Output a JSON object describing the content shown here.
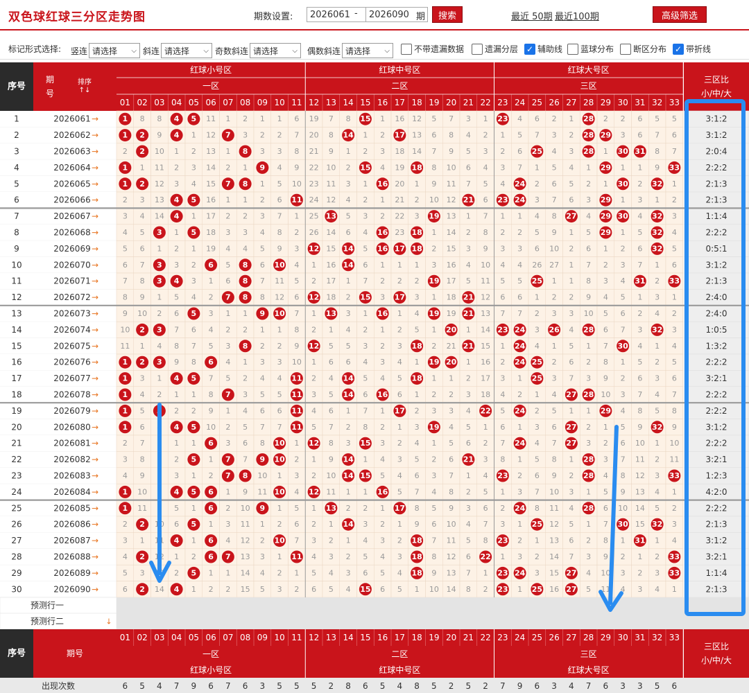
{
  "header": {
    "title": "双色球红球三分区走势图",
    "period_label": "期数设置:",
    "period_start": "2026061",
    "period_end": "2026090",
    "dash": "-",
    "period_unit": "期",
    "search_button": "搜索",
    "recent50": "最近 50期",
    "recent100": "最近100期",
    "advanced_button": "高级筛选"
  },
  "options": {
    "mark_label": "标记形式选择:",
    "selects": [
      {
        "label": "竖连",
        "value": "请选择"
      },
      {
        "label": "斜连",
        "value": "请选择"
      },
      {
        "label": "奇数斜连",
        "value": "请选择"
      },
      {
        "label": "偶数斜连",
        "value": "请选择"
      }
    ],
    "checkboxes": [
      {
        "label": "不带遗漏数据",
        "checked": false
      },
      {
        "label": "遗漏分层",
        "checked": false
      },
      {
        "label": "辅助线",
        "checked": true
      },
      {
        "label": "蓝球分布",
        "checked": false
      },
      {
        "label": "断区分布",
        "checked": false
      },
      {
        "label": "带折线",
        "checked": true
      }
    ]
  },
  "table": {
    "col_index": "序号",
    "col_period": "期号",
    "sort_label": "排序",
    "zone_names": [
      "红球小号区",
      "红球中号区",
      "红球大号区"
    ],
    "zone_labels": [
      "一区",
      "二区",
      "三区"
    ],
    "ratio_header": [
      "三区比",
      "小/中/大"
    ],
    "numbers": [
      "01",
      "02",
      "03",
      "04",
      "05",
      "06",
      "07",
      "08",
      "09",
      "10",
      "11",
      "12",
      "13",
      "14",
      "15",
      "16",
      "17",
      "18",
      "19",
      "20",
      "21",
      "22",
      "23",
      "24",
      "25",
      "26",
      "27",
      "28",
      "29",
      "30",
      "31",
      "32",
      "33"
    ],
    "predict_rows": [
      "预测行一",
      "预测行二"
    ],
    "count_label": "出现次数",
    "counts": [
      6,
      5,
      4,
      7,
      9,
      6,
      7,
      6,
      3,
      5,
      5,
      5,
      2,
      8,
      6,
      5,
      4,
      8,
      5,
      2,
      5,
      2,
      7,
      9,
      6,
      3,
      4,
      7,
      6,
      3,
      3,
      5,
      6
    ],
    "rows": [
      {
        "idx": 1,
        "period": "2026061",
        "ratio": "3:1:2",
        "cells": [
          1,
          8,
          8,
          4,
          5,
          11,
          1,
          2,
          1,
          1,
          6,
          19,
          7,
          8,
          15,
          1,
          16,
          12,
          5,
          7,
          3,
          1,
          23,
          4,
          6,
          2,
          1,
          28,
          2,
          2,
          6,
          5,
          5
        ]
      },
      {
        "idx": 2,
        "period": "2026062",
        "ratio": "3:1:2",
        "cells": [
          1,
          2,
          9,
          4,
          1,
          12,
          7,
          3,
          2,
          2,
          7,
          20,
          8,
          14,
          1,
          2,
          17,
          13,
          6,
          8,
          4,
          2,
          1,
          5,
          7,
          3,
          2,
          28,
          29,
          3,
          6,
          7,
          6
        ]
      },
      {
        "idx": 3,
        "period": "2026063",
        "ratio": "2:0:4",
        "cells": [
          2,
          2,
          10,
          1,
          2,
          13,
          1,
          8,
          3,
          3,
          8,
          21,
          9,
          1,
          2,
          3,
          18,
          14,
          7,
          9,
          5,
          3,
          2,
          6,
          25,
          4,
          3,
          28,
          1,
          30,
          31,
          8,
          7
        ]
      },
      {
        "idx": 4,
        "period": "2026064",
        "ratio": "2:2:2",
        "cells": [
          1,
          1,
          11,
          2,
          3,
          14,
          2,
          1,
          9,
          4,
          9,
          22,
          10,
          2,
          15,
          4,
          19,
          18,
          8,
          10,
          6,
          4,
          3,
          7,
          1,
          5,
          4,
          1,
          29,
          1,
          1,
          9,
          33
        ]
      },
      {
        "idx": 5,
        "period": "2026065",
        "ratio": "2:1:3",
        "cells": [
          1,
          2,
          12,
          3,
          4,
          15,
          7,
          8,
          1,
          5,
          10,
          23,
          11,
          3,
          1,
          16,
          20,
          1,
          9,
          11,
          7,
          5,
          4,
          24,
          2,
          6,
          5,
          2,
          1,
          30,
          2,
          32,
          1
        ]
      },
      {
        "idx": 6,
        "period": "2026066",
        "ratio": "2:1:3",
        "cells": [
          2,
          3,
          13,
          4,
          5,
          16,
          1,
          1,
          2,
          6,
          11,
          24,
          12,
          4,
          2,
          1,
          21,
          2,
          10,
          12,
          21,
          6,
          23,
          24,
          3,
          7,
          6,
          3,
          29,
          1,
          3,
          1,
          2
        ]
      },
      {
        "idx": 7,
        "period": "2026067",
        "ratio": "1:1:4",
        "cells": [
          3,
          4,
          14,
          4,
          1,
          17,
          2,
          2,
          3,
          7,
          1,
          25,
          13,
          5,
          3,
          2,
          22,
          3,
          19,
          13,
          1,
          7,
          1,
          1,
          4,
          8,
          27,
          4,
          29,
          30,
          4,
          32,
          3
        ]
      },
      {
        "idx": 8,
        "period": "2026068",
        "ratio": "2:2:2",
        "cells": [
          4,
          5,
          3,
          1,
          5,
          18,
          3,
          3,
          4,
          8,
          2,
          26,
          14,
          6,
          4,
          16,
          23,
          18,
          1,
          14,
          2,
          8,
          2,
          2,
          5,
          9,
          1,
          5,
          29,
          1,
          5,
          32,
          4
        ]
      },
      {
        "idx": 9,
        "period": "2026069",
        "ratio": "0:5:1",
        "cells": [
          5,
          6,
          1,
          2,
          1,
          19,
          4,
          4,
          5,
          9,
          3,
          12,
          15,
          14,
          5,
          16,
          17,
          18,
          2,
          15,
          3,
          9,
          3,
          3,
          6,
          10,
          2,
          6,
          1,
          2,
          6,
          32,
          5
        ]
      },
      {
        "idx": 10,
        "period": "2026070",
        "ratio": "3:1:2",
        "cells": [
          6,
          7,
          3,
          3,
          2,
          6,
          5,
          8,
          6,
          10,
          4,
          1,
          16,
          14,
          6,
          1,
          1,
          1,
          3,
          16,
          4,
          10,
          4,
          4,
          26,
          27,
          1,
          7,
          2,
          3,
          7,
          1,
          6
        ]
      },
      {
        "idx": 11,
        "period": "2026071",
        "ratio": "2:1:3",
        "cells": [
          7,
          8,
          3,
          4,
          3,
          1,
          6,
          8,
          7,
          11,
          5,
          2,
          17,
          1,
          7,
          2,
          2,
          2,
          19,
          17,
          5,
          11,
          5,
          5,
          25,
          1,
          1,
          8,
          3,
          4,
          31,
          2,
          33
        ]
      },
      {
        "idx": 12,
        "period": "2026072",
        "ratio": "2:4:0",
        "cells": [
          8,
          9,
          1,
          5,
          4,
          2,
          7,
          8,
          8,
          12,
          6,
          12,
          18,
          2,
          15,
          3,
          17,
          3,
          1,
          18,
          21,
          12,
          6,
          6,
          1,
          2,
          2,
          9,
          4,
          5,
          1,
          3,
          1
        ]
      },
      {
        "idx": 13,
        "period": "2026073",
        "ratio": "2:4:0",
        "cells": [
          9,
          10,
          2,
          6,
          5,
          3,
          1,
          1,
          9,
          10,
          7,
          1,
          13,
          3,
          1,
          16,
          1,
          4,
          19,
          19,
          21,
          13,
          7,
          7,
          2,
          3,
          3,
          10,
          5,
          6,
          2,
          4,
          2
        ]
      },
      {
        "idx": 14,
        "period": "2026074",
        "ratio": "1:0:5",
        "cells": [
          10,
          2,
          3,
          7,
          6,
          4,
          2,
          2,
          1,
          1,
          8,
          2,
          1,
          4,
          2,
          1,
          2,
          5,
          1,
          20,
          1,
          14,
          23,
          24,
          3,
          26,
          4,
          28,
          6,
          7,
          3,
          32,
          3
        ]
      },
      {
        "idx": 15,
        "period": "2026075",
        "ratio": "1:3:2",
        "cells": [
          11,
          1,
          4,
          8,
          7,
          5,
          3,
          8,
          2,
          2,
          9,
          12,
          5,
          5,
          3,
          2,
          3,
          18,
          2,
          21,
          21,
          15,
          1,
          24,
          4,
          1,
          5,
          1,
          7,
          30,
          4,
          1,
          4
        ]
      },
      {
        "idx": 16,
        "period": "2026076",
        "ratio": "2:2:2",
        "cells": [
          1,
          2,
          3,
          9,
          8,
          6,
          4,
          1,
          3,
          3,
          10,
          1,
          6,
          6,
          4,
          3,
          4,
          1,
          19,
          20,
          1,
          16,
          2,
          24,
          25,
          2,
          6,
          2,
          8,
          1,
          5,
          2,
          5
        ]
      },
      {
        "idx": 17,
        "period": "2026077",
        "ratio": "3:2:1",
        "cells": [
          1,
          3,
          1,
          4,
          5,
          7,
          5,
          2,
          4,
          4,
          11,
          2,
          4,
          14,
          5,
          4,
          5,
          18,
          1,
          1,
          2,
          17,
          3,
          1,
          25,
          3,
          7,
          3,
          9,
          2,
          6,
          3,
          6
        ]
      },
      {
        "idx": 18,
        "period": "2026078",
        "ratio": "2:2:2",
        "cells": [
          1,
          4,
          2,
          1,
          1,
          8,
          7,
          3,
          5,
          5,
          11,
          3,
          5,
          14,
          6,
          16,
          6,
          1,
          2,
          2,
          3,
          18,
          4,
          2,
          1,
          4,
          27,
          28,
          10,
          3,
          7,
          4,
          7
        ]
      },
      {
        "idx": 19,
        "period": "2026079",
        "ratio": "2:2:2",
        "cells": [
          1,
          5,
          3,
          2,
          2,
          9,
          1,
          4,
          6,
          6,
          11,
          4,
          6,
          1,
          7,
          1,
          17,
          2,
          3,
          3,
          4,
          22,
          5,
          24,
          2,
          5,
          1,
          1,
          29,
          4,
          8,
          5,
          8
        ]
      },
      {
        "idx": 20,
        "period": "2026080",
        "ratio": "3:1:2",
        "cells": [
          1,
          6,
          4,
          4,
          5,
          10,
          2,
          5,
          7,
          7,
          11,
          5,
          7,
          2,
          8,
          2,
          1,
          3,
          19,
          4,
          5,
          1,
          6,
          1,
          3,
          6,
          27,
          2,
          1,
          5,
          9,
          32,
          9
        ]
      },
      {
        "idx": 21,
        "period": "2026081",
        "ratio": "2:2:2",
        "cells": [
          2,
          7,
          5,
          1,
          1,
          6,
          3,
          6,
          8,
          10,
          1,
          12,
          8,
          3,
          15,
          3,
          2,
          4,
          1,
          5,
          6,
          2,
          7,
          24,
          4,
          7,
          27,
          3,
          2,
          6,
          10,
          1,
          10
        ]
      },
      {
        "idx": 22,
        "period": "2026082",
        "ratio": "3:2:1",
        "cells": [
          3,
          8,
          6,
          2,
          5,
          1,
          7,
          7,
          9,
          10,
          2,
          1,
          9,
          14,
          1,
          4,
          3,
          5,
          2,
          6,
          21,
          3,
          8,
          1,
          5,
          8,
          1,
          28,
          3,
          7,
          11,
          2,
          11
        ]
      },
      {
        "idx": 23,
        "period": "2026083",
        "ratio": "1:2:3",
        "cells": [
          4,
          9,
          7,
          3,
          1,
          2,
          7,
          8,
          10,
          1,
          3,
          2,
          10,
          14,
          15,
          5,
          4,
          6,
          3,
          7,
          1,
          4,
          23,
          2,
          6,
          9,
          2,
          28,
          4,
          8,
          12,
          3,
          33
        ]
      },
      {
        "idx": 24,
        "period": "2026084",
        "ratio": "4:2:0",
        "cells": [
          1,
          10,
          8,
          4,
          5,
          6,
          1,
          9,
          11,
          10,
          4,
          12,
          11,
          1,
          1,
          16,
          5,
          7,
          4,
          8,
          2,
          5,
          1,
          3,
          7,
          10,
          3,
          1,
          5,
          9,
          13,
          4,
          1
        ]
      },
      {
        "idx": 25,
        "period": "2026085",
        "ratio": "2:2:2",
        "cells": [
          1,
          11,
          9,
          5,
          1,
          6,
          2,
          10,
          9,
          1,
          5,
          1,
          13,
          2,
          2,
          1,
          17,
          8,
          5,
          9,
          3,
          6,
          2,
          24,
          8,
          11,
          4,
          28,
          6,
          10,
          14,
          5,
          2
        ]
      },
      {
        "idx": 26,
        "period": "2026086",
        "ratio": "2:1:3",
        "cells": [
          2,
          2,
          10,
          6,
          5,
          1,
          3,
          11,
          1,
          2,
          6,
          2,
          1,
          14,
          3,
          2,
          1,
          9,
          6,
          10,
          4,
          7,
          3,
          1,
          25,
          12,
          5,
          1,
          7,
          30,
          15,
          32,
          3
        ]
      },
      {
        "idx": 27,
        "period": "2026087",
        "ratio": "3:1:2",
        "cells": [
          3,
          1,
          11,
          4,
          1,
          6,
          4,
          12,
          2,
          10,
          7,
          3,
          2,
          1,
          4,
          3,
          2,
          18,
          7,
          11,
          5,
          8,
          23,
          2,
          1,
          13,
          6,
          2,
          8,
          1,
          31,
          1,
          4
        ]
      },
      {
        "idx": 28,
        "period": "2026088",
        "ratio": "3:2:1",
        "cells": [
          4,
          2,
          12,
          1,
          2,
          6,
          7,
          13,
          3,
          1,
          11,
          4,
          3,
          2,
          5,
          4,
          3,
          18,
          8,
          12,
          6,
          22,
          1,
          3,
          2,
          14,
          7,
          3,
          9,
          2,
          1,
          2,
          33
        ]
      },
      {
        "idx": 29,
        "period": "2026089",
        "ratio": "1:1:4",
        "cells": [
          5,
          3,
          13,
          2,
          5,
          1,
          1,
          14,
          4,
          2,
          1,
          5,
          4,
          3,
          6,
          5,
          4,
          18,
          9,
          13,
          7,
          1,
          23,
          24,
          3,
          15,
          27,
          4,
          10,
          3,
          2,
          3,
          33
        ]
      },
      {
        "idx": 30,
        "period": "2026090",
        "ratio": "2:1:3",
        "cells": [
          6,
          2,
          14,
          4,
          1,
          2,
          2,
          15,
          5,
          3,
          2,
          6,
          5,
          4,
          15,
          6,
          5,
          1,
          10,
          14,
          8,
          2,
          23,
          1,
          25,
          16,
          27,
          5,
          11,
          4,
          3,
          4,
          1
        ]
      }
    ]
  },
  "colors": {
    "red": "#c9141b",
    "dark_header": "#2b2b2b",
    "cell_bg": "#fdf2e6",
    "ratio_bg": "#eeeeee",
    "annotation_blue": "#2a8cf0"
  }
}
